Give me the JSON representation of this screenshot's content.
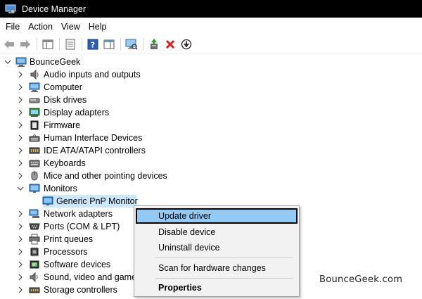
{
  "window": {
    "title": "Device Manager"
  },
  "menubar": {
    "items": [
      "File",
      "Action",
      "View",
      "Help"
    ]
  },
  "toolbar": {
    "buttons": [
      "back-icon",
      "forward-icon",
      "show-hide-console-tree-icon",
      "properties-icon",
      "help-icon",
      "action-pane-icon",
      "scan-hardware-icon",
      "update-driver-icon",
      "uninstall-icon",
      "disable-device-icon"
    ]
  },
  "tree": {
    "root": "BounceGeek",
    "categories": [
      {
        "label": "Audio inputs and outputs",
        "icon": "speaker-icon",
        "expanded": false
      },
      {
        "label": "Computer",
        "icon": "computer-icon",
        "expanded": false
      },
      {
        "label": "Disk drives",
        "icon": "disk-drive-icon",
        "expanded": false
      },
      {
        "label": "Display adapters",
        "icon": "display-adapter-icon",
        "expanded": false
      },
      {
        "label": "Firmware",
        "icon": "firmware-icon",
        "expanded": false
      },
      {
        "label": "Human Interface Devices",
        "icon": "hid-icon",
        "expanded": false
      },
      {
        "label": "IDE ATA/ATAPI controllers",
        "icon": "ide-controller-icon",
        "expanded": false
      },
      {
        "label": "Keyboards",
        "icon": "keyboard-icon",
        "expanded": false
      },
      {
        "label": "Mice and other pointing devices",
        "icon": "mouse-icon",
        "expanded": false
      },
      {
        "label": "Monitors",
        "icon": "monitor-icon",
        "expanded": true,
        "children": [
          "Generic PnP Monitor"
        ]
      },
      {
        "label": "Network adapters",
        "icon": "network-adapter-icon",
        "expanded": false
      },
      {
        "label": "Ports (COM & LPT)",
        "icon": "port-icon",
        "expanded": false
      },
      {
        "label": "Print queues",
        "icon": "printer-icon",
        "expanded": false
      },
      {
        "label": "Processors",
        "icon": "processor-icon",
        "expanded": false
      },
      {
        "label": "Software devices",
        "icon": "software-device-icon",
        "expanded": false
      },
      {
        "label": "Sound, video and game",
        "icon": "sound-video-icon",
        "expanded": false
      },
      {
        "label": "Storage controllers",
        "icon": "storage-controller-icon",
        "expanded": false
      }
    ]
  },
  "context_menu": {
    "update_driver": "Update driver",
    "disable_device": "Disable device",
    "uninstall_device": "Uninstall device",
    "scan": "Scan for hardware changes",
    "properties": "Properties"
  },
  "watermark": "BounceGeek.com",
  "colors": {
    "titlebar_bg": "#000000",
    "selection_bg": "#cce8ff",
    "menu_highlight": "#91c9f7",
    "menu_bg": "#f2f2f2"
  }
}
